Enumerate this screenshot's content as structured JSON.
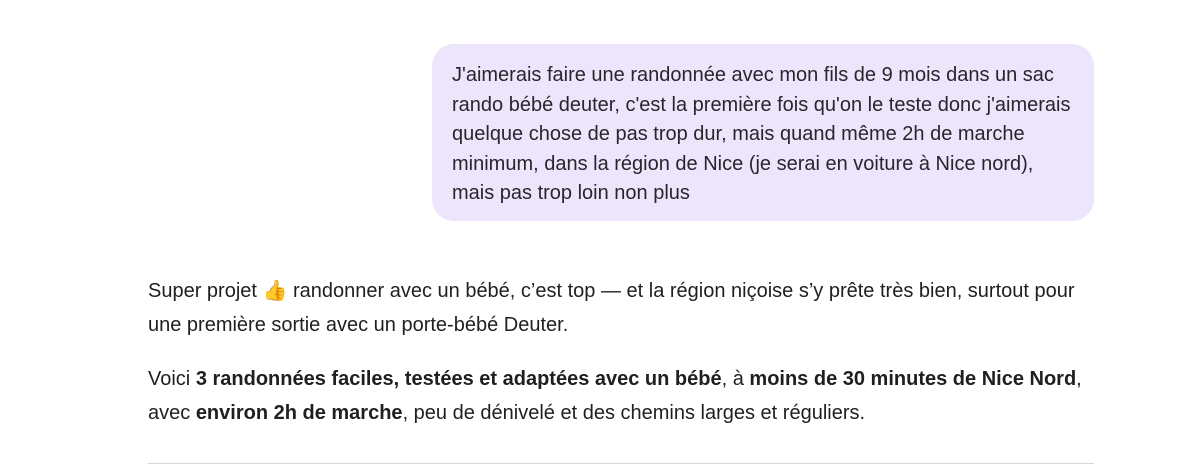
{
  "user_message": {
    "text": "J'aimerais faire une randonnée avec mon fils de 9 mois dans un sac rando bébé deuter, c'est la première fois qu'on le teste donc j'aimerais quelque chose de pas trop dur, mais quand même 2h de marche minimum, dans la région de Nice (je serai en voiture à Nice nord), mais pas trop loin non plus"
  },
  "assistant_message": {
    "paragraph1": {
      "text": "Super projet 👍 randonner avec un bébé, c’est top — et la région niçoise s’y prête très bien, surtout pour une première sortie avec un porte-bébé Deuter."
    },
    "paragraph2": {
      "intro": "Voici ",
      "bold1": "3 randonnées faciles, testées et adaptées avec un bébé",
      "mid1": ", à ",
      "bold2": "moins de 30 minutes de Nice Nord",
      "mid2": ", avec ",
      "bold3": "environ 2h de marche",
      "end": ", peu de dénivelé et des chemins larges et réguliers."
    }
  }
}
